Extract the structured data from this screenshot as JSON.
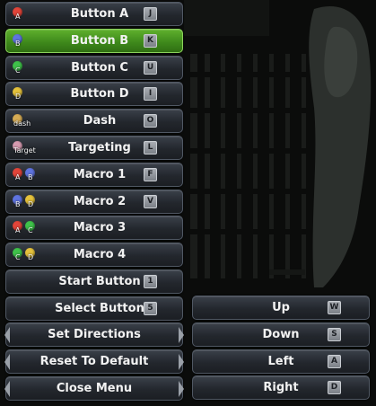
{
  "colors": {
    "red": "#e2453a",
    "blue": "#5f74e0",
    "green": "#3fc24a",
    "yellow": "#e5c23c",
    "tan": "#d6ac55",
    "pink": "#d69ab0",
    "selected": "#4a9a24"
  },
  "left_column": [
    {
      "label": "Button A",
      "key": "J",
      "icons": [
        {
          "color": "red",
          "text": "A"
        }
      ]
    },
    {
      "label": "Button B",
      "key": "K",
      "icons": [
        {
          "color": "blue",
          "text": "B"
        }
      ],
      "selected": true
    },
    {
      "label": "Button C",
      "key": "U",
      "icons": [
        {
          "color": "green",
          "text": "C"
        }
      ]
    },
    {
      "label": "Button D",
      "key": "I",
      "icons": [
        {
          "color": "yellow",
          "text": "D"
        }
      ]
    },
    {
      "label": "Dash",
      "key": "O",
      "icons": [
        {
          "color": "tan",
          "text": "dash",
          "word": true
        }
      ]
    },
    {
      "label": "Targeting",
      "key": "L",
      "icons": [
        {
          "color": "pink",
          "text": "Target",
          "word": true
        }
      ]
    },
    {
      "label": "Macro 1",
      "key": "F",
      "icons": [
        {
          "color": "red",
          "text": "A"
        },
        {
          "color": "blue",
          "text": "B"
        }
      ]
    },
    {
      "label": "Macro 2",
      "key": "V",
      "icons": [
        {
          "color": "blue",
          "text": "B"
        },
        {
          "color": "yellow",
          "text": "D"
        }
      ]
    },
    {
      "label": "Macro 3",
      "key": "",
      "icons": [
        {
          "color": "red",
          "text": "A"
        },
        {
          "color": "green",
          "text": "C"
        }
      ]
    },
    {
      "label": "Macro 4",
      "key": "",
      "icons": [
        {
          "color": "green",
          "text": "C"
        },
        {
          "color": "yellow",
          "text": "D"
        }
      ]
    },
    {
      "label": "Start Button",
      "key": "1",
      "icons": []
    },
    {
      "label": "Select Button",
      "key": "5",
      "icons": []
    }
  ],
  "menu_items": [
    {
      "label": "Set Directions"
    },
    {
      "label": "Reset To Default"
    },
    {
      "label": "Close Menu"
    }
  ],
  "directions": [
    {
      "label": "Up",
      "key": "W"
    },
    {
      "label": "Down",
      "key": "S"
    },
    {
      "label": "Left",
      "key": "A"
    },
    {
      "label": "Right",
      "key": "D"
    }
  ]
}
